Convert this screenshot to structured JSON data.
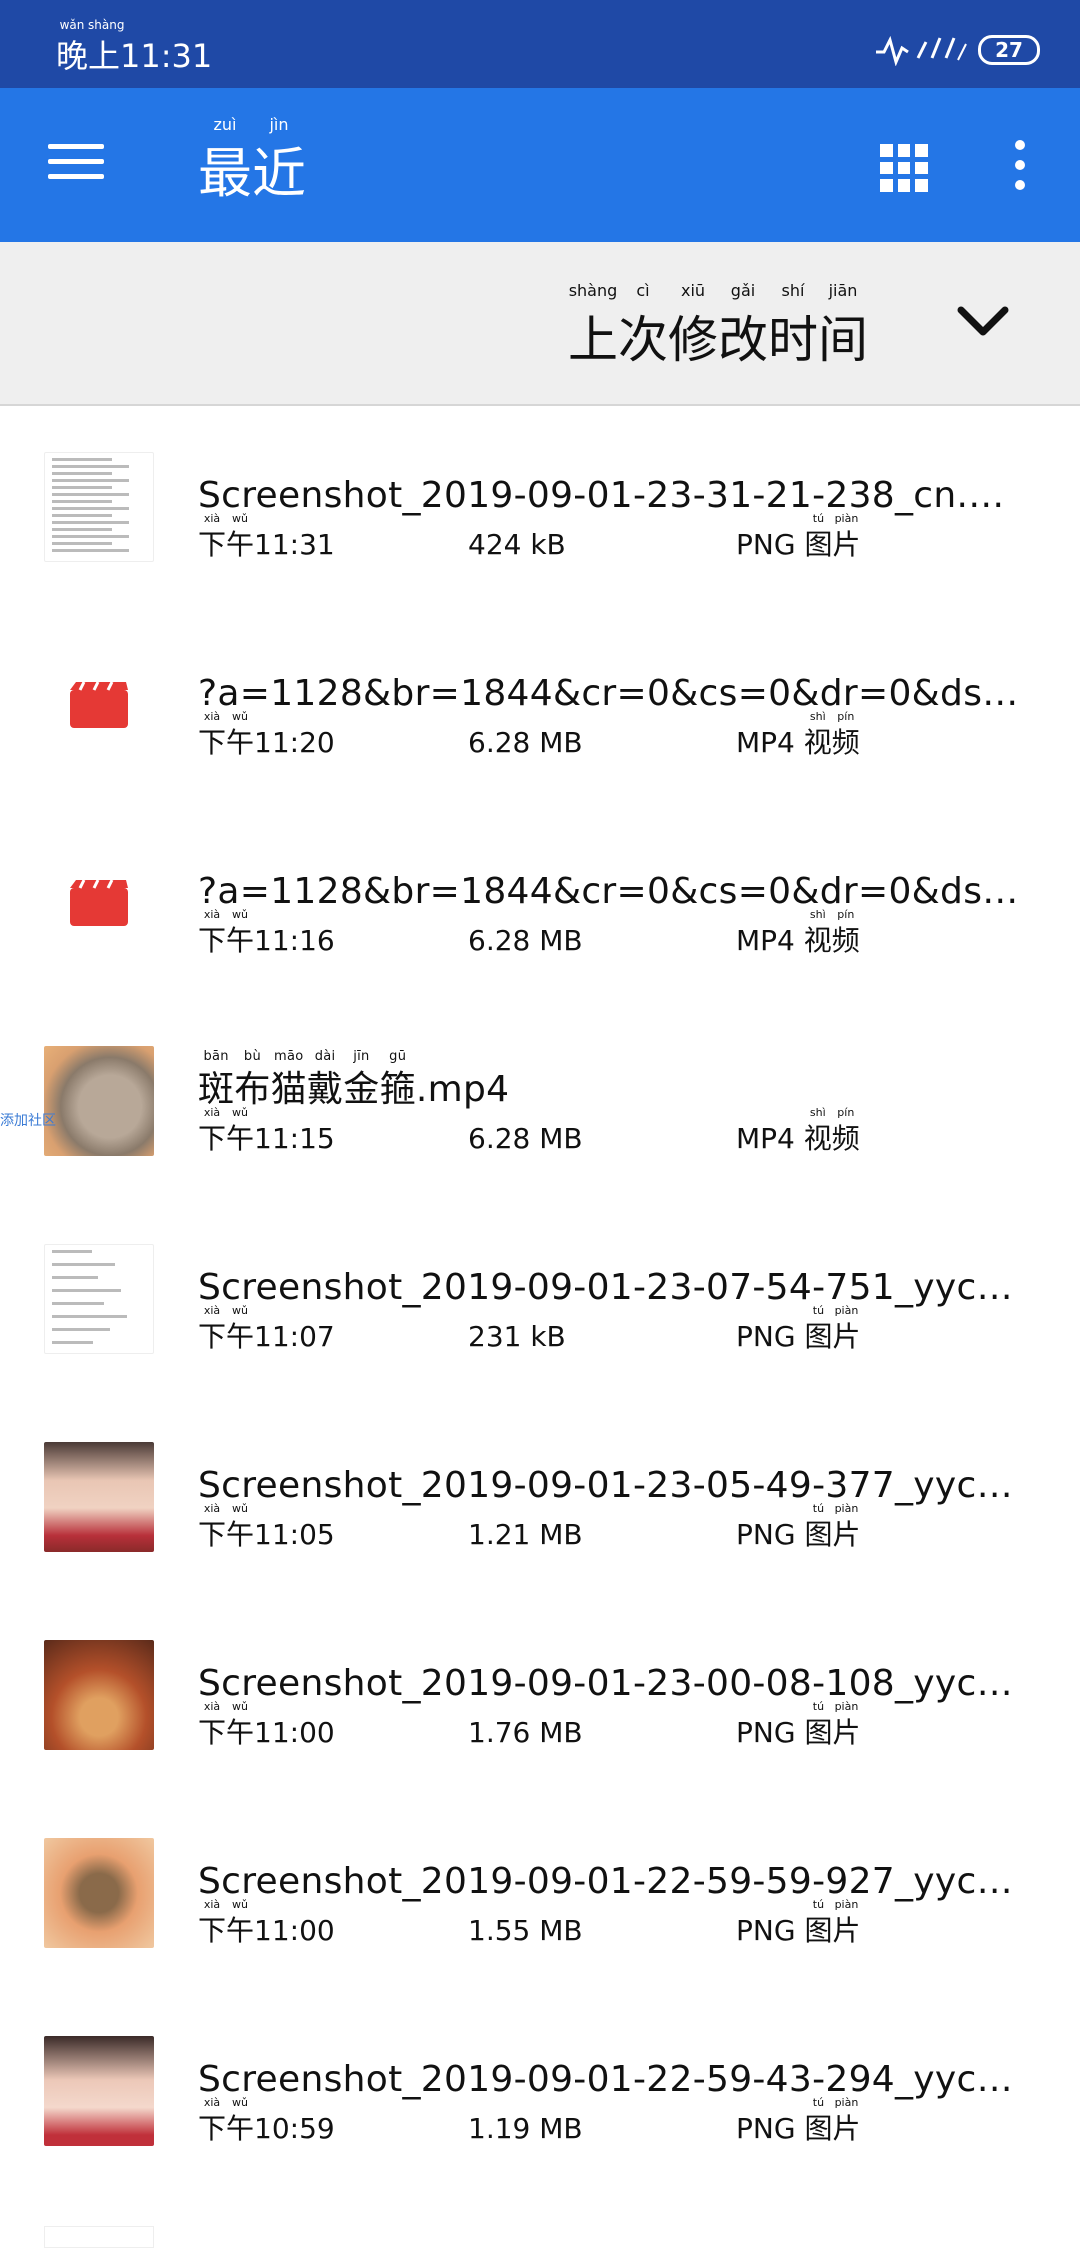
{
  "status_bar": {
    "time_pinyin": [
      "wǎn",
      "shàng"
    ],
    "time_han": [
      "晚",
      "上"
    ],
    "time": "11:31",
    "battery": "27"
  },
  "app_bar": {
    "title_han": [
      "最",
      "近"
    ],
    "title_pinyin": [
      "zuì",
      "jìn"
    ],
    "menu_icon": "hamburger-menu-icon",
    "grid_icon": "grid-view-icon",
    "more_icon": "more-vert-icon"
  },
  "sort": {
    "label_han": [
      "上",
      "次",
      "修",
      "改",
      "时",
      "间"
    ],
    "label_pinyin": [
      "shàng",
      "cì",
      "xiū",
      "gǎi",
      "shí",
      "jiān"
    ]
  },
  "files": [
    {
      "name": "Screenshot_2019-09-01-23-31-21-238_cn.…",
      "time": "11:31",
      "size": "424 kB",
      "ext": "PNG",
      "kind_han": [
        "图",
        "片"
      ],
      "kind_pinyin": [
        "tú",
        "piàn"
      ],
      "thumb": "doc"
    },
    {
      "name": "?a=1128&br=1844&cr=0&cs=0&dr=0&ds=1…",
      "time": "11:20",
      "size": "6.28 MB",
      "ext": "MP4",
      "kind_han": [
        "视",
        "频"
      ],
      "kind_pinyin": [
        "shì",
        "pín"
      ],
      "thumb": "video"
    },
    {
      "name": "?a=1128&br=1844&cr=0&cs=0&dr=0&ds=1…",
      "time": "11:16",
      "size": "6.28 MB",
      "ext": "MP4",
      "kind_han": [
        "视",
        "频"
      ],
      "kind_pinyin": [
        "shì",
        "pín"
      ],
      "thumb": "video"
    },
    {
      "name": "斑布猫戴金箍.mp4",
      "name_pinyin": [
        "bān",
        "bù",
        "māo",
        "dài",
        "jīn",
        "gū"
      ],
      "time": "11:15",
      "size": "6.28 MB",
      "ext": "MP4",
      "kind_han": [
        "视",
        "频"
      ],
      "kind_pinyin": [
        "shì",
        "pín"
      ],
      "thumb": "cat"
    },
    {
      "name": "Screenshot_2019-09-01-23-07-54-751_yyc…",
      "time": "11:07",
      "size": "231 kB",
      "ext": "PNG",
      "kind_han": [
        "图",
        "片"
      ],
      "kind_pinyin": [
        "tú",
        "piàn"
      ],
      "thumb": "list"
    },
    {
      "name": "Screenshot_2019-09-01-23-05-49-377_yyc…",
      "time": "11:05",
      "size": "1.21 MB",
      "ext": "PNG",
      "kind_han": [
        "图",
        "片"
      ],
      "kind_pinyin": [
        "tú",
        "piàn"
      ],
      "thumb": "girl"
    },
    {
      "name": "Screenshot_2019-09-01-23-00-08-108_yyc…",
      "time": "11:00",
      "size": "1.76 MB",
      "ext": "PNG",
      "kind_han": [
        "图",
        "片"
      ],
      "kind_pinyin": [
        "tú",
        "piàn"
      ],
      "thumb": "warm"
    },
    {
      "name": "Screenshot_2019-09-01-22-59-59-927_yyc…",
      "time": "11:00",
      "size": "1.55 MB",
      "ext": "PNG",
      "kind_han": [
        "图",
        "片"
      ],
      "kind_pinyin": [
        "tú",
        "piàn"
      ],
      "thumb": "bear"
    },
    {
      "name": "Screenshot_2019-09-01-22-59-43-294_yyc…",
      "time": "10:59",
      "size": "1.19 MB",
      "ext": "PNG",
      "kind_han": [
        "图",
        "片"
      ],
      "kind_pinyin": [
        "tú",
        "piàn"
      ],
      "thumb": "girl2"
    }
  ],
  "time_prefix_han": [
    "下",
    "午"
  ],
  "time_prefix_pinyin": [
    "xià",
    "wǔ"
  ],
  "edge_text": "添加社区"
}
